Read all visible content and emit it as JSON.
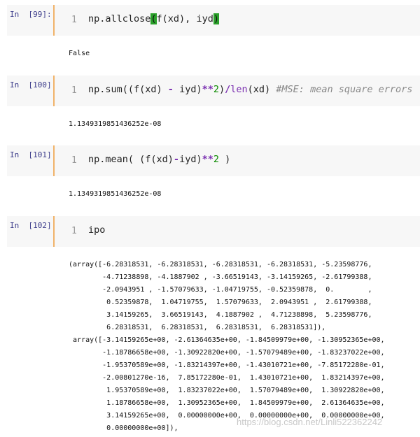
{
  "cells": [
    {
      "prompt": "In  [99]:",
      "line": "1",
      "code_parts": [
        "np.allclose",
        "(",
        "f(xd), iyd",
        ")"
      ],
      "output": "False"
    },
    {
      "prompt": "In  [100]:",
      "line": "1",
      "code_parts": [
        "np.sum((f(xd) ",
        "-",
        " iyd)",
        "**",
        "2",
        ")",
        "/",
        "len",
        "(xd) ",
        "#MSE: mean square errors"
      ],
      "output": "1.1349319851436252e-08"
    },
    {
      "prompt": "In  [101]:",
      "line": "1",
      "code_parts": [
        "np.mean( (f(xd)",
        "-",
        "iyd)",
        "**",
        "2",
        " )"
      ],
      "output": "1.1349319851436252e-08"
    },
    {
      "prompt": "In  [102]:",
      "line": "1",
      "code_parts": [
        "ipo"
      ],
      "output_lines": [
        "(array([-6.28318531, -6.28318531, -6.28318531, -6.28318531, -5.23598776,",
        "        -4.71238898, -4.1887902 , -3.66519143, -3.14159265, -2.61799388,",
        "        -2.0943951 , -1.57079633, -1.04719755, -0.52359878,  0.        ,",
        "         0.52359878,  1.04719755,  1.57079633,  2.0943951 ,  2.61799388,",
        "         3.14159265,  3.66519143,  4.1887902 ,  4.71238898,  5.23598776,",
        "         6.28318531,  6.28318531,  6.28318531,  6.28318531]),",
        " array([-3.14159265e+00, -2.61364635e+00, -1.84509979e+00, -1.30952365e+00,",
        "        -1.18786658e+00, -1.30922820e+00, -1.57079489e+00, -1.83237022e+00,",
        "        -1.95370589e+00, -1.83214397e+00, -1.43010721e+00, -7.85172280e-01,",
        "        -2.00801270e-16,  7.85172280e-01,  1.43010721e+00,  1.83214397e+00,",
        "         1.95370589e+00,  1.83237022e+00,  1.57079489e+00,  1.30922820e+00,",
        "         1.18786658e+00,  1.30952365e+00,  1.84509979e+00,  2.61364635e+00,",
        "         3.14159265e+00,  0.00000000e+00,  0.00000000e+00,  0.00000000e+00,",
        "         0.00000000e+00]),"
      ]
    }
  ],
  "watermark": "https://blog.csdn.net/Linli522362242"
}
